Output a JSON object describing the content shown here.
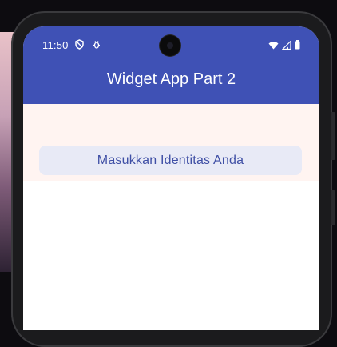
{
  "status_bar": {
    "time": "11:50",
    "left_icons": [
      "shield-icon",
      "debug-icon"
    ],
    "right_icons": [
      "wifi-icon",
      "signal-icon",
      "battery-icon"
    ]
  },
  "app_bar": {
    "title": "Widget App Part 2",
    "color": "#3f51b5"
  },
  "content": {
    "identity_button_label": "Masukkan Identitas Anda",
    "button_background": "#e8eaf6",
    "button_text_color": "#3f4fa5",
    "card_background": "#fff4f1"
  }
}
